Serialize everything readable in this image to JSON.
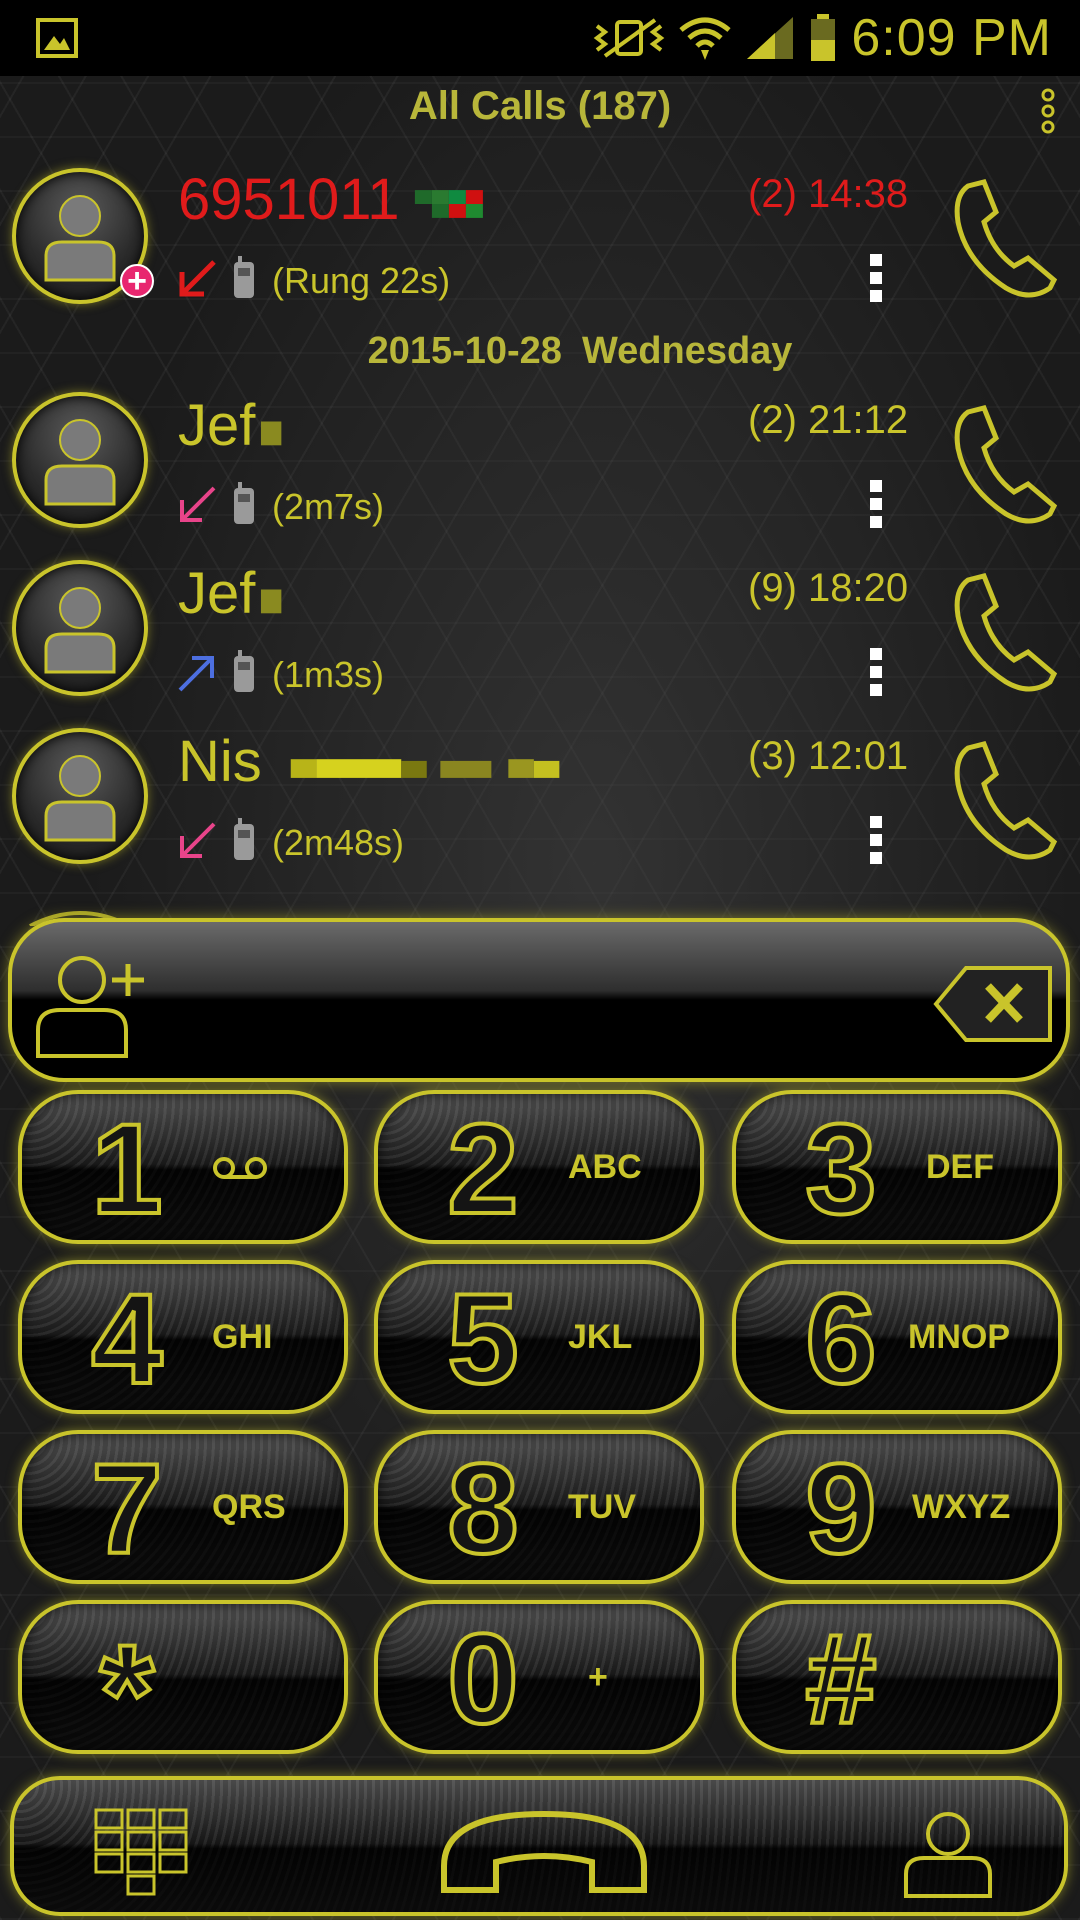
{
  "status_bar": {
    "time": "6:09 PM",
    "icons": [
      "gallery-icon",
      "vibrate-mute-icon",
      "wifi-icon",
      "signal-icon",
      "battery-icon"
    ]
  },
  "header": {
    "title": "All Calls (187)"
  },
  "calls": [
    {
      "name": "6951011",
      "time": "(2) 14:38",
      "duration": "(Rung 22s)",
      "direction": "missed",
      "color": "#e01b1b"
    },
    {
      "name": "Jef",
      "time": "(2) 21:12",
      "duration": "(2m7s)",
      "direction": "incoming",
      "color": "#e8448a"
    },
    {
      "name": "Jef",
      "time": "(9) 18:20",
      "duration": "(1m3s)",
      "direction": "outgoing",
      "color": "#4d6fe0"
    },
    {
      "name": "Nis",
      "time": "(3) 12:01",
      "duration": "(2m48s)",
      "direction": "incoming",
      "color": "#e8448a"
    }
  ],
  "date_separator": {
    "date": "2015-10-28",
    "weekday": "Wednesday"
  },
  "dialer": {
    "input_value": "",
    "keys": [
      {
        "digit": "1",
        "letters": ""
      },
      {
        "digit": "2",
        "letters": "ABC"
      },
      {
        "digit": "3",
        "letters": "DEF"
      },
      {
        "digit": "4",
        "letters": "GHI"
      },
      {
        "digit": "5",
        "letters": "JKL"
      },
      {
        "digit": "6",
        "letters": "MNOP"
      },
      {
        "digit": "7",
        "letters": "QRS"
      },
      {
        "digit": "8",
        "letters": "TUV"
      },
      {
        "digit": "9",
        "letters": "WXYZ"
      },
      {
        "digit": "*",
        "letters": ""
      },
      {
        "digit": "0",
        "letters": "+"
      },
      {
        "digit": "#",
        "letters": ""
      }
    ]
  },
  "theme": {
    "accent": "#c9c42b",
    "missed": "#e01b1b",
    "badge": "#e8266f"
  }
}
